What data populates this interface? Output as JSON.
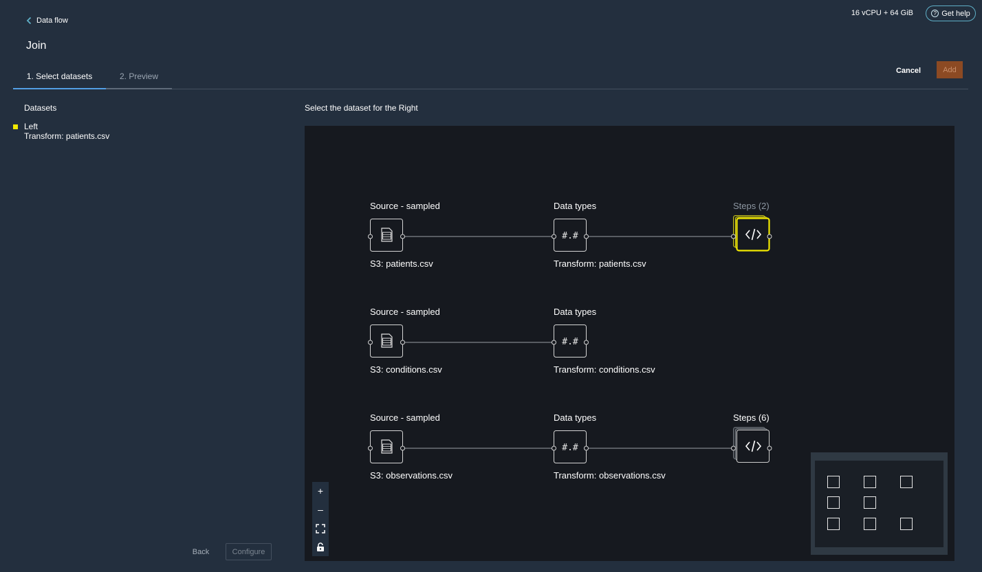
{
  "header": {
    "back_label": "Data flow",
    "title": "Join",
    "resources": "16 vCPU + 64 GiB",
    "help_label": "Get help"
  },
  "tabs": [
    {
      "label": "1. Select datasets",
      "active": true
    },
    {
      "label": "2. Preview",
      "active": false
    }
  ],
  "actions": {
    "cancel_label": "Cancel",
    "add_label": "Add"
  },
  "sidebar": {
    "heading": "Datasets",
    "left": {
      "label": "Left",
      "dataset": "Transform: patients.csv",
      "color": "#f2e900"
    },
    "back_label": "Back",
    "configure_label": "Configure"
  },
  "main": {
    "heading": "Select the dataset for the Right",
    "rows": [
      {
        "source": {
          "title": "Source - sampled",
          "name": "S3: patients.csv",
          "icon": "file-icon"
        },
        "types": {
          "title": "Data types",
          "name": "Transform: patients.csv",
          "icon": "hash-icon"
        },
        "steps": {
          "title": "Steps (2)",
          "icon": "code-icon",
          "selected": true
        }
      },
      {
        "source": {
          "title": "Source - sampled",
          "name": "S3: conditions.csv",
          "icon": "file-icon"
        },
        "types": {
          "title": "Data types",
          "name": "Transform: conditions.csv",
          "icon": "hash-icon"
        }
      },
      {
        "source": {
          "title": "Source - sampled",
          "name": "S3: observations.csv",
          "icon": "file-icon"
        },
        "types": {
          "title": "Data types",
          "name": "Transform: observations.csv",
          "icon": "hash-icon"
        },
        "steps": {
          "title": "Steps (6)",
          "icon": "code-icon",
          "selected": false
        }
      }
    ]
  },
  "zoom_controls": [
    "zoom-in-icon",
    "zoom-out-icon",
    "fit-view-icon",
    "lock-icon"
  ],
  "colors": {
    "selected": "#f2e900",
    "accent": "#539fe5",
    "add_button": "#8c4a23"
  }
}
